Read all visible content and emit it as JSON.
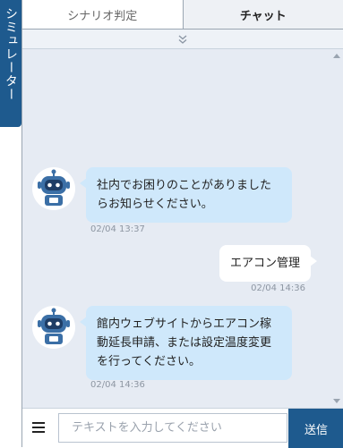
{
  "side_tab": {
    "label": "シミュレーター"
  },
  "tabs": [
    {
      "label": "シナリオ判定",
      "active": false
    },
    {
      "label": "チャット",
      "active": true
    }
  ],
  "collapse_bar": {
    "icon": "double-chevron-down-icon",
    "glyph": "⌄⌄"
  },
  "messages": [
    {
      "sender": "bot",
      "text": "社内でお困りのことがありましたらお知らせください。",
      "time": "02/04 13:37"
    },
    {
      "sender": "user",
      "text": "エアコン管理",
      "time": "02/04 14:36"
    },
    {
      "sender": "bot",
      "text": "館内ウェブサイトからエアコン稼動延長申請、または設定温度変更を行ってください。",
      "time": "02/04 14:36"
    }
  ],
  "footer": {
    "menu_icon": "hamburger-menu-icon",
    "input_placeholder": "テキストを入力してください",
    "input_value": "",
    "send_label": "送信"
  },
  "colors": {
    "brand": "#1e5a8e",
    "chat_bg": "#e6ebf3",
    "bot_bubble": "#cfe8fb",
    "user_bubble": "#ffffff"
  }
}
